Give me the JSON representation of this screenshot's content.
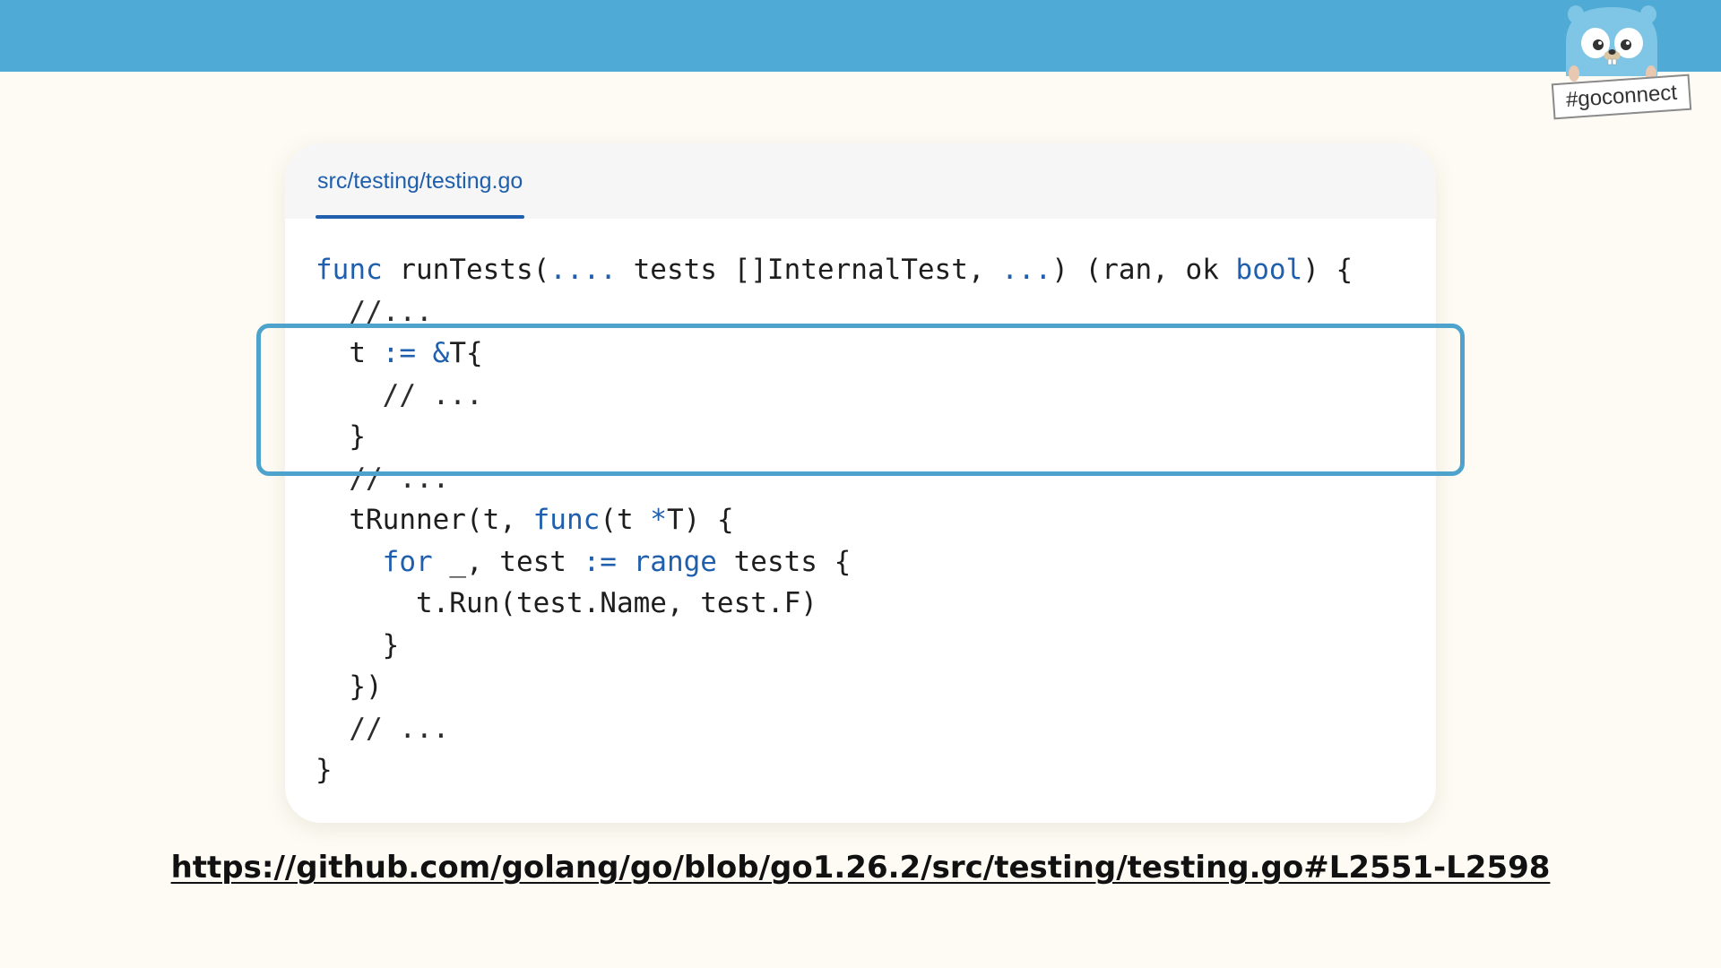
{
  "colors": {
    "top_bar": "#50aad6",
    "page_background": "#fdfbf3",
    "keyword": "#1f5fad",
    "highlight_border": "#4ea3cc",
    "tab_accent": "#1f5fad"
  },
  "header": {
    "hashtag": "#goconnect",
    "mascot_icon": "gopher-icon"
  },
  "code_card": {
    "tab_label": "src/testing/testing.go",
    "lines": [
      [
        {
          "text": "func",
          "type": "kw"
        },
        {
          "text": " runTests(",
          "type": "id"
        },
        {
          "text": "....",
          "type": "op"
        },
        {
          "text": " tests []InternalTest, ",
          "type": "id"
        },
        {
          "text": "...",
          "type": "op"
        },
        {
          "text": ") (ran, ok ",
          "type": "id"
        },
        {
          "text": "bool",
          "type": "kw"
        },
        {
          "text": ") {",
          "type": "id"
        }
      ],
      [
        {
          "text": "  //...",
          "type": "comment"
        }
      ],
      [
        {
          "text": "  t ",
          "type": "id"
        },
        {
          "text": ":=",
          "type": "op"
        },
        {
          "text": " ",
          "type": "id"
        },
        {
          "text": "&",
          "type": "op"
        },
        {
          "text": "T{",
          "type": "id"
        }
      ],
      [
        {
          "text": "    // ...",
          "type": "comment"
        }
      ],
      [
        {
          "text": "  }",
          "type": "id"
        }
      ],
      [
        {
          "text": "  // ...",
          "type": "comment"
        }
      ],
      [
        {
          "text": "  tRunner(t, ",
          "type": "id"
        },
        {
          "text": "func",
          "type": "kw"
        },
        {
          "text": "(t ",
          "type": "id"
        },
        {
          "text": "*",
          "type": "op"
        },
        {
          "text": "T) {",
          "type": "id"
        }
      ],
      [
        {
          "text": "    ",
          "type": "id"
        },
        {
          "text": "for",
          "type": "kw"
        },
        {
          "text": " _, test ",
          "type": "id"
        },
        {
          "text": ":=",
          "type": "op"
        },
        {
          "text": " ",
          "type": "id"
        },
        {
          "text": "range",
          "type": "kw"
        },
        {
          "text": " tests {",
          "type": "id"
        }
      ],
      [
        {
          "text": "      t.Run(test.Name, test.F)",
          "type": "id"
        }
      ],
      [
        {
          "text": "    }",
          "type": "id"
        }
      ],
      [
        {
          "text": "  })",
          "type": "id"
        }
      ],
      [
        {
          "text": "  // ...",
          "type": "comment"
        }
      ],
      [
        {
          "text": "}",
          "type": "id"
        }
      ]
    ]
  },
  "footer": {
    "source_url": "https://github.com/golang/go/blob/go1.26.2/src/testing/testing.go#L2551-L2598"
  }
}
